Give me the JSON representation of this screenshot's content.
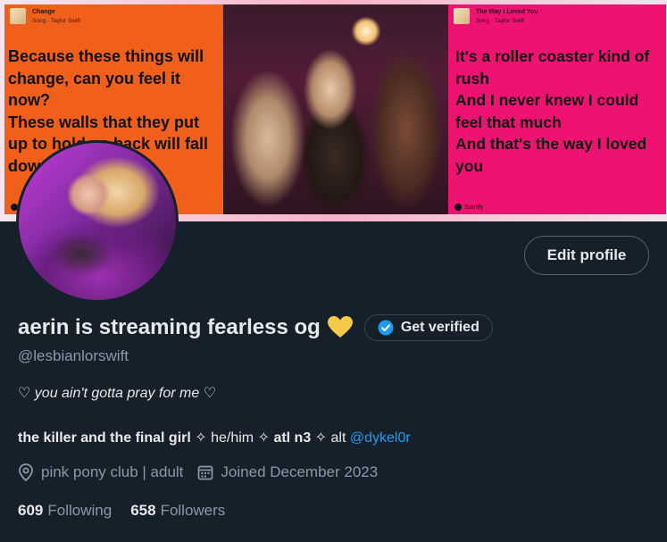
{
  "banner": {
    "left_card": {
      "song_title": "Change",
      "song_meta": "Song · Taylor Swift",
      "lyrics": "Because these things will\nchange, can you feel it\nnow?\nThese walls that they put\nup to hold us back will fall\ndown",
      "bg": "#f0601a"
    },
    "right_card": {
      "song_title": "The Way I Loved You",
      "song_meta": "Song · Taylor Swift",
      "lyrics": "It's a roller coaster kind of\nrush\nAnd I never knew I could\nfeel that much\nAnd that's the way I loved\nyou",
      "spotify_label": "Spotify",
      "bg": "#ee1271"
    }
  },
  "profile": {
    "edit_label": "Edit profile",
    "name": "aerin is streaming fearless og",
    "name_emoji": "yellow-heart-icon",
    "verify_label": "Get verified",
    "handle": "@lesbianlorswift",
    "bio_line1": "♡ you ain't gotta pray for me ♡",
    "bio_line2_bold": "the killer and the final girl",
    "bio_line2_rest1": " ✧ he/him ✧ ",
    "bio_line2_bold2": "atl n3",
    "bio_line2_rest2": " ✧ alt ",
    "bio_mention": "@dykel0r",
    "location": "pink pony club | adult",
    "joined": "Joined December 2023",
    "following_count": "609",
    "following_label": "Following",
    "followers_count": "658",
    "followers_label": "Followers"
  },
  "colors": {
    "background": "#15202b",
    "accent": "#1d9bf0",
    "muted": "#8b98a5",
    "heart": "#f7c948"
  }
}
